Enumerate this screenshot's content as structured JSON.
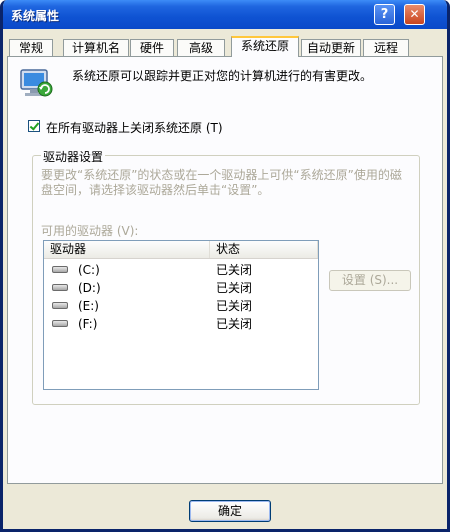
{
  "window": {
    "title": "系统属性",
    "help_glyph": "?",
    "close_glyph": "✕"
  },
  "tabs": [
    {
      "label": "常规"
    },
    {
      "label": "计算机名"
    },
    {
      "label": "硬件"
    },
    {
      "label": "高级"
    },
    {
      "label": "系统还原",
      "active": true
    },
    {
      "label": "自动更新"
    },
    {
      "label": "远程"
    }
  ],
  "description": {
    "icon": "system-restore-icon",
    "text": "系统还原可以跟踪并更正对您的计算机进行的有害更改。"
  },
  "disable_checkbox": {
    "checked": true,
    "label": "在所有驱动器上关闭系统还原 (T)"
  },
  "drive_settings": {
    "title": "驱动器设置",
    "description": "要更改“系统还原”的状态或在一个驱动器上可供“系统还原”使用的磁盘空间，请选择该驱动器然后单击“设置”。",
    "available_label": "可用的驱动器 (V):",
    "columns": [
      "驱动器",
      "状态"
    ],
    "drives": [
      {
        "name": "(C:)",
        "status": "已关闭",
        "icon": "drive-icon"
      },
      {
        "name": "(D:)",
        "status": "已关闭",
        "icon": "drive-icon"
      },
      {
        "name": "(E:)",
        "status": "已关闭",
        "icon": "drive-icon"
      },
      {
        "name": "(F:)",
        "status": "已关闭",
        "icon": "drive-icon"
      }
    ],
    "settings_button": "设置 (S)..."
  },
  "buttons": {
    "ok": "确定"
  },
  "colors": {
    "title_bar": "#0f53d3",
    "dialog_bg": "#ece9d8",
    "active_tab_accent": "#ffc73c",
    "disabled_text": "#aca899"
  }
}
